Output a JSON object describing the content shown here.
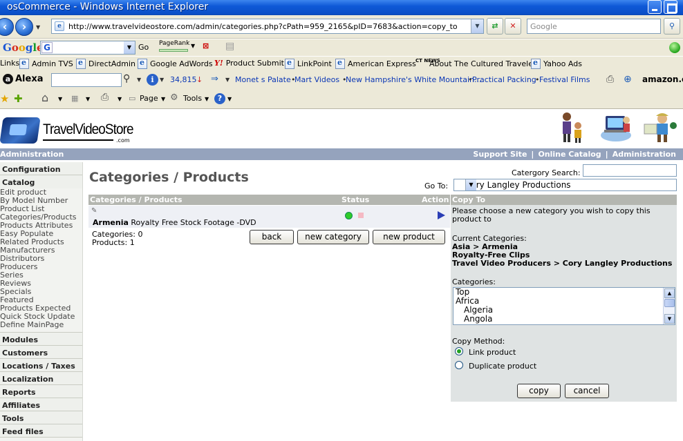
{
  "window": {
    "title": "osCommerce - Windows Internet Explorer",
    "url": "http://www.travelvideostore.com/admin/categories.php?cPath=959_2165&pID=7683&action=copy_to",
    "search_placeholder": "Google"
  },
  "google_toolbar": {
    "logo": "Google",
    "go_label": "Go",
    "pagerank_label": "PageRank"
  },
  "links_bar": {
    "label": "Links",
    "items": [
      "Admin TVS",
      "DirectAdmin",
      "Google AdWords",
      "Product Submit",
      "LinkPoint",
      "American Express",
      "About The Cultured Traveler",
      "Yahoo Ads"
    ],
    "ct_badge": "CT NEWS"
  },
  "alexa_bar": {
    "logo": "Alexa",
    "rank": "34,815",
    "links": [
      "Monet s Palate",
      "Mart Videos",
      "New Hampshire's White Mountain...",
      "Practical Packing",
      "Festival Films"
    ],
    "amazon": "amazon.com"
  },
  "command_bar": {
    "page_label": "Page",
    "tools_label": "Tools"
  },
  "header": {
    "brand": "TravelVideoStore",
    "brand_suffix": ".com",
    "admin_label": "Administration",
    "top_links": [
      "Support Site",
      "Online Catalog",
      "Administration"
    ]
  },
  "left_menu": {
    "configuration": "Configuration",
    "catalog": "Catalog",
    "catalog_items": [
      "Edit product",
      "By Model Number",
      "Product List",
      "Categories/Products",
      "Products Attributes",
      "Easy Populate",
      "Related Products",
      "Manufacturers",
      "Distributors",
      "Producers",
      "Series",
      "Reviews",
      "Specials",
      "Featured",
      "Products Expected",
      "Quick Stock Update",
      "Define MainPage"
    ],
    "sections": [
      "Modules",
      "Customers",
      "Locations / Taxes",
      "Localization",
      "Reports",
      "Affiliates",
      "Tools",
      "Feed files"
    ]
  },
  "main": {
    "heading": "Categories / Products",
    "category_search_label": "Catergory Search:",
    "goto_label": "Go To:",
    "goto_value": "Cory Langley Productions",
    "table_headers": {
      "name": "Categories / Products",
      "status": "Status",
      "action": "Action"
    },
    "product_prefix": "Armenia",
    "product_name": " Royalty Free Stock Footage -DVD",
    "categories_count": "Categories: 0",
    "products_count": "Products: 1",
    "buttons": {
      "back": "back",
      "new_category": "new category",
      "new_product": "new product"
    }
  },
  "copy_panel": {
    "title": "Copy To",
    "instruction_line1": "Please choose a new category you wish to copy this",
    "instruction_line2": "product to",
    "current_label": "Current Categories:",
    "current": [
      "Asia > Armenia",
      "Royalty-Free Clips",
      "Travel Video Producers > Cory Langley Productions"
    ],
    "categories_label": "Categories:",
    "category_options": [
      "Top",
      "Africa",
      "Algeria",
      "Angola"
    ],
    "method_label": "Copy Method:",
    "method_link": "Link product",
    "method_duplicate": "Duplicate product",
    "method_selected": "Link product",
    "buttons": {
      "copy": "copy",
      "cancel": "cancel"
    }
  }
}
